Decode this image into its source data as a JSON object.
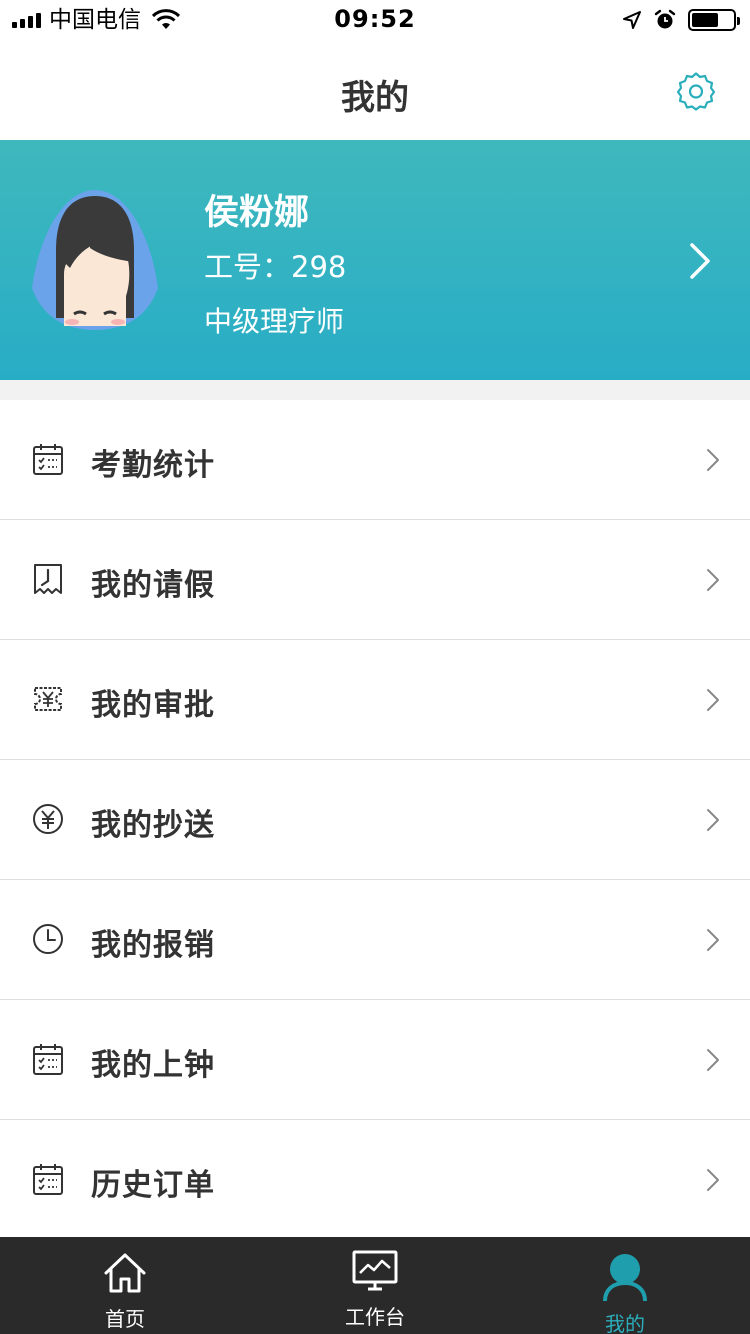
{
  "status_bar": {
    "carrier": "中国电信",
    "time": "09:52"
  },
  "nav": {
    "title": "我的",
    "settings_icon": "gear-icon"
  },
  "profile": {
    "name": "侯粉娜",
    "employee_id": "工号：298",
    "job_title": "中级理疗师"
  },
  "colors": {
    "accent": "#2aaebc",
    "header_gradient_start": "#3fb8bd",
    "header_gradient_end": "#28adc6",
    "tab_bar": "#2a2a2a"
  },
  "menu": {
    "items": [
      {
        "label": "考勤统计",
        "icon": "calendar-check-icon"
      },
      {
        "label": "我的请假",
        "icon": "clock-ticket-icon"
      },
      {
        "label": "我的审批",
        "icon": "yuan-ticket-icon"
      },
      {
        "label": "我的抄送",
        "icon": "yuan-circle-icon"
      },
      {
        "label": "我的报销",
        "icon": "clock-icon"
      },
      {
        "label": "我的上钟",
        "icon": "calendar-check-icon"
      },
      {
        "label": "历史订单",
        "icon": "calendar-check-icon"
      }
    ]
  },
  "tabbar": {
    "tabs": [
      {
        "label": "首页",
        "icon": "home-icon"
      },
      {
        "label": "工作台",
        "icon": "monitor-chart-icon"
      },
      {
        "label": "我的",
        "icon": "user-icon",
        "active": true
      }
    ]
  }
}
